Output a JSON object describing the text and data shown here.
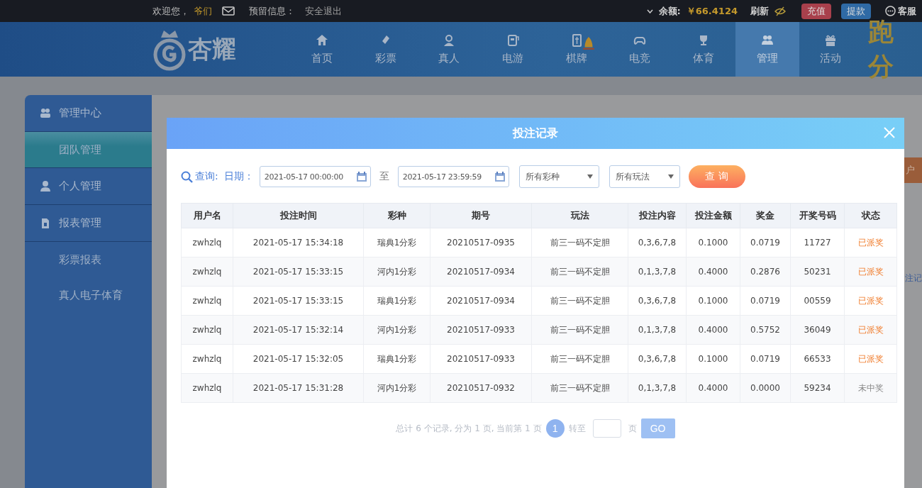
{
  "top_bar": {
    "greeting": "欢迎您，",
    "username": "爷们",
    "reserved_label": "预留信息：",
    "logout": "安全退出",
    "balance_label": "余额:",
    "balance": "￥66.4124",
    "refresh": "刷新",
    "deposit": "充值",
    "withdraw": "提款",
    "service": "客服"
  },
  "nav": {
    "logo": "杏耀",
    "items": [
      {
        "label": "首页",
        "selected": false
      },
      {
        "label": "彩票",
        "selected": false
      },
      {
        "label": "真人",
        "selected": false
      },
      {
        "label": "电游",
        "selected": false
      },
      {
        "label": "棋牌",
        "selected": false
      },
      {
        "label": "电竞",
        "selected": false
      },
      {
        "label": "体育",
        "selected": false
      },
      {
        "label": "管理",
        "selected": true
      },
      {
        "label": "活动",
        "selected": false
      }
    ],
    "promo": "跑分"
  },
  "sidebar": {
    "items": [
      {
        "label": "管理中心",
        "children": [
          {
            "label": "团队管理",
            "selected": true
          }
        ]
      },
      {
        "label": "个人管理"
      },
      {
        "label": "报表管理",
        "children": [
          {
            "label": "彩票报表",
            "selected": false
          },
          {
            "label": "真人电子体育",
            "selected": false
          }
        ]
      }
    ]
  },
  "page": {
    "side_button": "户",
    "side_link": "注记"
  },
  "modal": {
    "title": "投注记录",
    "filter": {
      "query_label": "查询:",
      "date_label": "日期：",
      "start": "2021-05-17 00:00:00",
      "to": "至",
      "end": "2021-05-17 23:59:59",
      "lottery": "所有彩种",
      "play": "所有玩法",
      "submit": "查 询"
    },
    "table": {
      "columns": [
        "用户名",
        "投注时间",
        "彩种",
        "期号",
        "玩法",
        "投注内容",
        "投注金额",
        "奖金",
        "开奖号码",
        "状态"
      ],
      "rows": [
        {
          "cells": [
            "zwhzlq",
            "2021-05-17 15:34:18",
            "瑞典1分彩",
            "20210517-0935",
            "前三一码不定胆",
            "0,3,6,7,8",
            "0.1000",
            "0.0719",
            "11727"
          ],
          "status": "已派奖",
          "paid": true
        },
        {
          "cells": [
            "zwhzlq",
            "2021-05-17 15:33:15",
            "河内1分彩",
            "20210517-0934",
            "前三一码不定胆",
            "0,1,3,7,8",
            "0.4000",
            "0.2876",
            "50231"
          ],
          "status": "已派奖",
          "paid": true
        },
        {
          "cells": [
            "zwhzlq",
            "2021-05-17 15:33:15",
            "瑞典1分彩",
            "20210517-0934",
            "前三一码不定胆",
            "0,3,6,7,8",
            "0.1000",
            "0.0719",
            "00559"
          ],
          "status": "已派奖",
          "paid": true
        },
        {
          "cells": [
            "zwhzlq",
            "2021-05-17 15:32:14",
            "河内1分彩",
            "20210517-0933",
            "前三一码不定胆",
            "0,1,3,7,8",
            "0.4000",
            "0.5752",
            "36049"
          ],
          "status": "已派奖",
          "paid": true
        },
        {
          "cells": [
            "zwhzlq",
            "2021-05-17 15:32:05",
            "瑞典1分彩",
            "20210517-0933",
            "前三一码不定胆",
            "0,3,6,7,8",
            "0.1000",
            "0.0719",
            "66533"
          ],
          "status": "已派奖",
          "paid": true
        },
        {
          "cells": [
            "zwhzlq",
            "2021-05-17 15:31:28",
            "河内1分彩",
            "20210517-0932",
            "前三一码不定胆",
            "0,1,3,7,8",
            "0.4000",
            "0.0000",
            "59234"
          ],
          "status": "未中奖",
          "paid": false
        }
      ]
    },
    "pagination": {
      "summary": "总计 6 个记录, 分为 1 页, 当前第 1 页",
      "pages": [
        {
          "label": "1",
          "selected": true
        }
      ],
      "goto": "转至",
      "unit": "页",
      "go": "GO"
    }
  }
}
